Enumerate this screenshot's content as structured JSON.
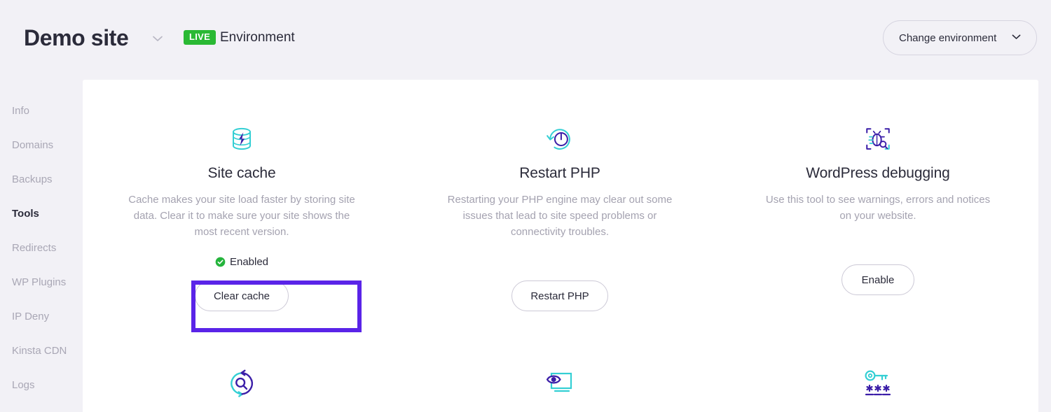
{
  "header": {
    "site_title": "Demo site",
    "title_chevron_icon": "chevron-down-icon",
    "live_badge": "LIVE",
    "environment_label": "Environment",
    "change_environment_label": "Change environment",
    "change_environment_chevron_icon": "chevron-down-icon"
  },
  "sidebar": {
    "items": [
      {
        "label": "Info",
        "active": false
      },
      {
        "label": "Domains",
        "active": false
      },
      {
        "label": "Backups",
        "active": false
      },
      {
        "label": "Tools",
        "active": true
      },
      {
        "label": "Redirects",
        "active": false
      },
      {
        "label": "WP Plugins",
        "active": false
      },
      {
        "label": "IP Deny",
        "active": false
      },
      {
        "label": "Kinsta CDN",
        "active": false
      },
      {
        "label": "Logs",
        "active": false
      }
    ]
  },
  "tools": [
    {
      "icon": "database-cache-bolt-icon",
      "title": "Site cache",
      "description": "Cache makes your site load faster by storing site data. Clear it to make sure your site shows the most recent version.",
      "status": "Enabled",
      "status_icon": "check-circle-icon",
      "button": "Clear cache",
      "highlighted": true
    },
    {
      "icon": "restart-power-icon",
      "title": "Restart PHP",
      "description": "Restarting your PHP engine may clear out some issues that lead to site speed problems or connectivity troubles.",
      "status": "",
      "status_icon": "",
      "button": "Restart PHP",
      "highlighted": false
    },
    {
      "icon": "bug-debug-icon",
      "title": "WordPress debugging",
      "description": "Use this tool to see warnings, errors and notices on your website.",
      "status": "",
      "status_icon": "",
      "button": "Enable",
      "highlighted": false
    }
  ],
  "bottom_tools": [
    {
      "icon": "search-replace-icon"
    },
    {
      "icon": "eye-screen-icon"
    },
    {
      "icon": "key-password-icon"
    }
  ],
  "colors": {
    "page_background": "#f2f1f6",
    "card_background": "#ffffff",
    "accent_purple": "#5a24e8",
    "live_green": "#2ab934",
    "status_green": "#25b43c",
    "text_dark": "#2b2b3a",
    "text_muted": "#a4a2b0",
    "icon_teal": "#34cfd4",
    "icon_purple": "#3b1ea8"
  }
}
